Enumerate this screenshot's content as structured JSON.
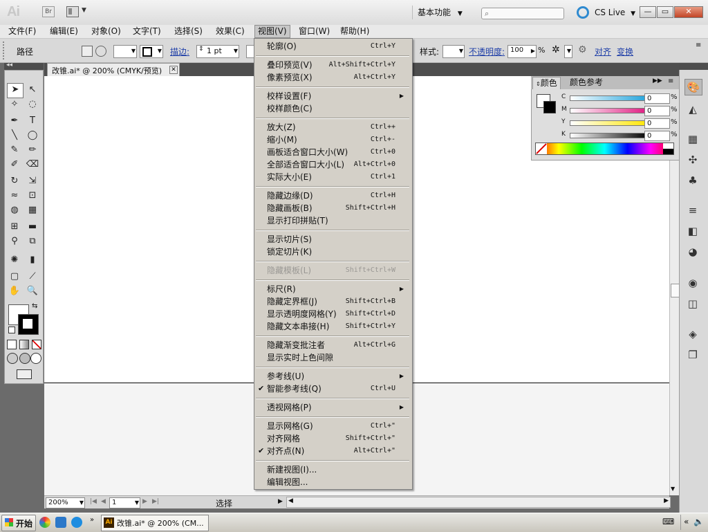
{
  "titlebar": {
    "app_logo": "Ai",
    "bridge_label": "Br",
    "workspace": "基本功能",
    "search_placeholder": "",
    "cslive": "CS Live",
    "colors": {
      "bg": "#e5e5e5"
    }
  },
  "menubar": {
    "items": [
      "文件(F)",
      "编辑(E)",
      "对象(O)",
      "文字(T)",
      "选择(S)",
      "效果(C)",
      "视图(V)",
      "窗口(W)",
      "帮助(H)"
    ],
    "active_index": 6
  },
  "controlbar": {
    "path_label": "路径",
    "stroke_link": "描边:",
    "stroke_weight": "1 pt",
    "style_label": "样式:",
    "opacity_link": "不透明度:",
    "opacity_value": "100",
    "opacity_unit": "%",
    "align_link": "对齐",
    "transform_link": "变换"
  },
  "document": {
    "tab_label": "改锥.ai* @ 200% (CMYK/预览)",
    "close_glyph": "✕"
  },
  "statusbar": {
    "zoom": "200%",
    "artboard": "1",
    "tool_status": "选择"
  },
  "color_panel": {
    "tabs": [
      "颜色",
      "颜色参考"
    ],
    "channels": [
      {
        "label": "C",
        "value": "0",
        "unit": "%",
        "color": "#1fa3dc"
      },
      {
        "label": "M",
        "value": "0",
        "unit": "%",
        "color": "#e0177f"
      },
      {
        "label": "Y",
        "value": "0",
        "unit": "%",
        "color": "#ffe600"
      },
      {
        "label": "K",
        "value": "0",
        "unit": "%",
        "color": "#000000"
      }
    ]
  },
  "view_menu": {
    "items": [
      {
        "label": "轮廓(O)",
        "shortcut": "Ctrl+Y"
      },
      {
        "sep": true
      },
      {
        "label": "叠印预览(V)",
        "shortcut": "Alt+Shift+Ctrl+Y"
      },
      {
        "label": "像素预览(X)",
        "shortcut": "Alt+Ctrl+Y"
      },
      {
        "sep": true
      },
      {
        "label": "校样设置(F)",
        "submenu": true
      },
      {
        "label": "校样颜色(C)"
      },
      {
        "sep": true
      },
      {
        "label": "放大(Z)",
        "shortcut": "Ctrl++"
      },
      {
        "label": "缩小(M)",
        "shortcut": "Ctrl+-"
      },
      {
        "label": "画板适合窗口大小(W)",
        "shortcut": "Ctrl+0"
      },
      {
        "label": "全部适合窗口大小(L)",
        "shortcut": "Alt+Ctrl+0"
      },
      {
        "label": "实际大小(E)",
        "shortcut": "Ctrl+1"
      },
      {
        "sep": true
      },
      {
        "label": "隐藏边缘(D)",
        "shortcut": "Ctrl+H"
      },
      {
        "label": "隐藏画板(B)",
        "shortcut": "Shift+Ctrl+H"
      },
      {
        "label": "显示打印拼贴(T)"
      },
      {
        "sep": true
      },
      {
        "label": "显示切片(S)"
      },
      {
        "label": "锁定切片(K)"
      },
      {
        "sep": true
      },
      {
        "label": "隐藏模板(L)",
        "shortcut": "Shift+Ctrl+W",
        "disabled": true
      },
      {
        "sep": true
      },
      {
        "label": "标尺(R)",
        "submenu": true
      },
      {
        "label": "隐藏定界框(J)",
        "shortcut": "Shift+Ctrl+B"
      },
      {
        "label": "显示透明度网格(Y)",
        "shortcut": "Shift+Ctrl+D"
      },
      {
        "label": "隐藏文本串接(H)",
        "shortcut": "Shift+Ctrl+Y"
      },
      {
        "sep": true
      },
      {
        "label": "隐藏渐变批注者",
        "shortcut": "Alt+Ctrl+G"
      },
      {
        "label": "显示实时上色间隙"
      },
      {
        "sep": true
      },
      {
        "label": "参考线(U)",
        "submenu": true
      },
      {
        "label": "智能参考线(Q)",
        "shortcut": "Ctrl+U",
        "checked": true
      },
      {
        "sep": true
      },
      {
        "label": "透视网格(P)",
        "submenu": true
      },
      {
        "sep": true
      },
      {
        "label": "显示网格(G)",
        "shortcut": "Ctrl+\""
      },
      {
        "label": "对齐网格",
        "shortcut": "Shift+Ctrl+\""
      },
      {
        "label": "对齐点(N)",
        "shortcut": "Alt+Ctrl+\"",
        "checked": true
      },
      {
        "sep": true
      },
      {
        "label": "新建视图(I)..."
      },
      {
        "label": "编辑视图..."
      }
    ]
  },
  "taskbar": {
    "start_label": "开始",
    "task_label": "改锥.ai* @ 200% (CM..."
  }
}
